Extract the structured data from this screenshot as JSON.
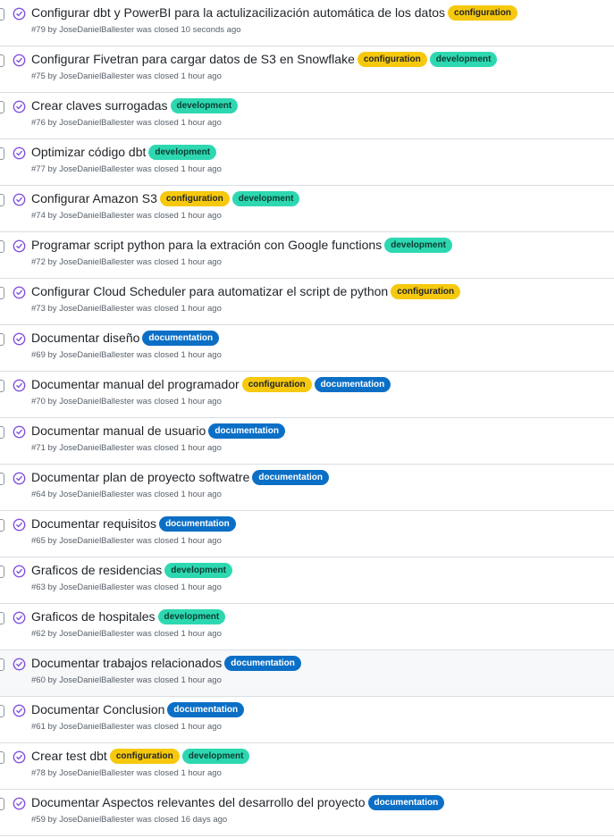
{
  "colors": {
    "closed_icon": "#8250df",
    "configuration_label": "#f6c90e",
    "development_label": "#2dd8b1",
    "documentation_label": "#0b6fc6",
    "row_divider": "#d8dee4",
    "meta_text": "#57606a"
  },
  "issues": [
    {
      "title": "Configurar dbt y PowerBI para la actulizacilización automática de los datos",
      "number": "#79",
      "by": "by",
      "author": "JoseDanielBallester",
      "closed_text": "was closed",
      "time": "10 seconds ago",
      "labels": [
        {
          "name": "configuration",
          "kind": "configuration"
        }
      ]
    },
    {
      "title": "Configurar Fivetran para cargar datos de S3 en Snowflake",
      "number": "#75",
      "by": "by",
      "author": "JoseDanielBallester",
      "closed_text": "was closed",
      "time": "1 hour ago",
      "labels": [
        {
          "name": "configuration",
          "kind": "configuration"
        },
        {
          "name": "development",
          "kind": "development"
        }
      ]
    },
    {
      "title": "Crear claves surrogadas",
      "number": "#76",
      "by": "by",
      "author": "JoseDanielBallester",
      "closed_text": "was closed",
      "time": "1 hour ago",
      "labels": [
        {
          "name": "development",
          "kind": "development"
        }
      ]
    },
    {
      "title": "Optimizar código dbt",
      "number": "#77",
      "by": "by",
      "author": "JoseDanielBallester",
      "closed_text": "was closed",
      "time": "1 hour ago",
      "labels": [
        {
          "name": "development",
          "kind": "development"
        }
      ]
    },
    {
      "title": "Configurar Amazon S3",
      "number": "#74",
      "by": "by",
      "author": "JoseDanielBallester",
      "closed_text": "was closed",
      "time": "1 hour ago",
      "labels": [
        {
          "name": "configuration",
          "kind": "configuration"
        },
        {
          "name": "development",
          "kind": "development"
        }
      ]
    },
    {
      "title": "Programar script python para la extración con Google functions",
      "number": "#72",
      "by": "by",
      "author": "JoseDanielBallester",
      "closed_text": "was closed",
      "time": "1 hour ago",
      "labels": [
        {
          "name": "development",
          "kind": "development"
        }
      ]
    },
    {
      "title": "Configurar Cloud Scheduler para automatizar el script de python",
      "number": "#73",
      "by": "by",
      "author": "JoseDanielBallester",
      "closed_text": "was closed",
      "time": "1 hour ago",
      "labels": [
        {
          "name": "configuration",
          "kind": "configuration"
        }
      ]
    },
    {
      "title": "Documentar diseño",
      "number": "#69",
      "by": "by",
      "author": "JoseDanielBallester",
      "closed_text": "was closed",
      "time": "1 hour ago",
      "labels": [
        {
          "name": "documentation",
          "kind": "documentation"
        }
      ]
    },
    {
      "title": "Documentar manual del programador",
      "number": "#70",
      "by": "by",
      "author": "JoseDanielBallester",
      "closed_text": "was closed",
      "time": "1 hour ago",
      "labels": [
        {
          "name": "configuration",
          "kind": "configuration"
        },
        {
          "name": "documentation",
          "kind": "documentation"
        }
      ]
    },
    {
      "title": "Documentar manual de usuario",
      "number": "#71",
      "by": "by",
      "author": "JoseDanielBallester",
      "closed_text": "was closed",
      "time": "1 hour ago",
      "labels": [
        {
          "name": "documentation",
          "kind": "documentation"
        }
      ]
    },
    {
      "title": "Documentar plan de proyecto softwatre",
      "number": "#64",
      "by": "by",
      "author": "JoseDanielBallester",
      "closed_text": "was closed",
      "time": "1 hour ago",
      "labels": [
        {
          "name": "documentation",
          "kind": "documentation"
        }
      ]
    },
    {
      "title": "Documentar requisitos",
      "number": "#65",
      "by": "by",
      "author": "JoseDanielBallester",
      "closed_text": "was closed",
      "time": "1 hour ago",
      "labels": [
        {
          "name": "documentation",
          "kind": "documentation"
        }
      ]
    },
    {
      "title": "Graficos de residencias",
      "number": "#63",
      "by": "by",
      "author": "JoseDanielBallester",
      "closed_text": "was closed",
      "time": "1 hour ago",
      "labels": [
        {
          "name": "development",
          "kind": "development"
        }
      ]
    },
    {
      "title": "Graficos de hospitales",
      "number": "#62",
      "by": "by",
      "author": "JoseDanielBallester",
      "closed_text": "was closed",
      "time": "1 hour ago",
      "labels": [
        {
          "name": "development",
          "kind": "development"
        }
      ]
    },
    {
      "title": "Documentar trabajos relacionados",
      "number": "#60",
      "by": "by",
      "author": "JoseDanielBallester",
      "closed_text": "was closed",
      "time": "1 hour ago",
      "hovered": true,
      "labels": [
        {
          "name": "documentation",
          "kind": "documentation"
        }
      ]
    },
    {
      "title": "Documentar Conclusion",
      "number": "#61",
      "by": "by",
      "author": "JoseDanielBallester",
      "closed_text": "was closed",
      "time": "1 hour ago",
      "labels": [
        {
          "name": "documentation",
          "kind": "documentation"
        }
      ]
    },
    {
      "title": "Crear test dbt",
      "number": "#78",
      "by": "by",
      "author": "JoseDanielBallester",
      "closed_text": "was closed",
      "time": "1 hour ago",
      "labels": [
        {
          "name": "configuration",
          "kind": "configuration"
        },
        {
          "name": "development",
          "kind": "development"
        }
      ]
    },
    {
      "title": "Documentar Aspectos relevantes del desarrollo del proyecto",
      "number": "#59",
      "by": "by",
      "author": "JoseDanielBallester",
      "closed_text": "was closed",
      "time": "16 days ago",
      "labels": [
        {
          "name": "documentation",
          "kind": "documentation"
        }
      ]
    }
  ]
}
